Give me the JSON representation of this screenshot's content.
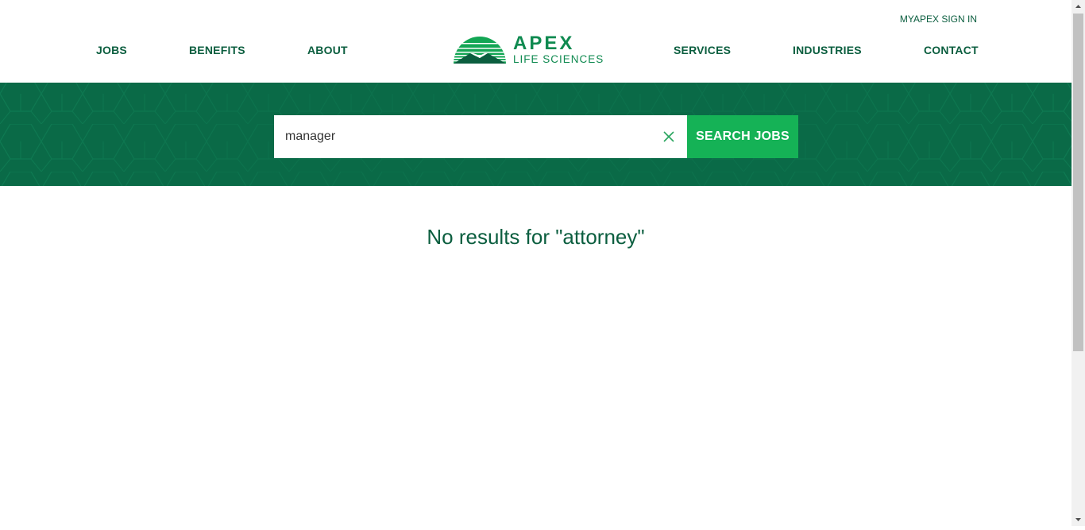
{
  "header": {
    "signin_label": "MYAPEX SIGN IN",
    "nav_left": [
      "JOBS",
      "BENEFITS",
      "ABOUT"
    ],
    "nav_right": [
      "SERVICES",
      "INDUSTRIES",
      "CONTACT"
    ],
    "logo": {
      "name": "APEX",
      "tagline": "LIFE SCIENCES"
    }
  },
  "search": {
    "value": "manager",
    "button_label": "SEARCH JOBS",
    "clear_icon": "close-icon"
  },
  "results": {
    "message": "No results for \"attorney\""
  },
  "colors": {
    "brand_dark_green": "#0b5e3f",
    "hero_green": "#0a6a47",
    "accent_green": "#15b256",
    "logo_green": "#0f8a50"
  }
}
